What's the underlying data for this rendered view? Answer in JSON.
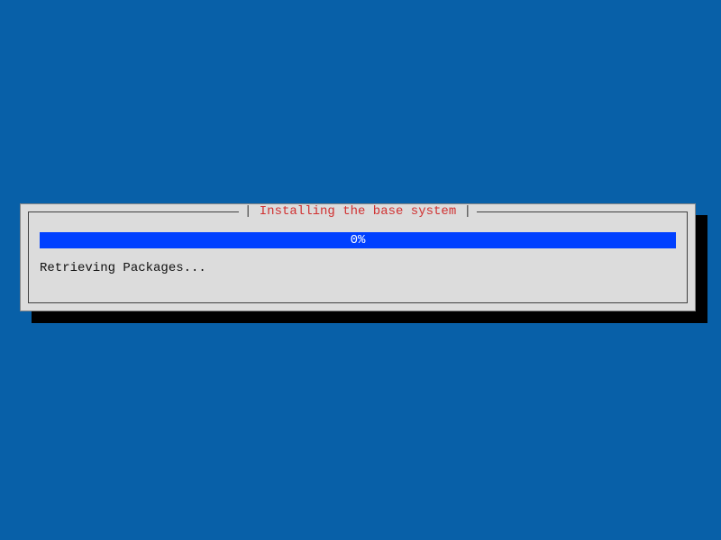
{
  "dialog": {
    "title": "Installing the base system",
    "progress_percent_label": "0%",
    "status_text": "Retrieving Packages..."
  },
  "colors": {
    "background": "#0860a8",
    "panel": "#dcdcdc",
    "title_accent": "#d03030",
    "progress_fill": "#0040ff"
  }
}
